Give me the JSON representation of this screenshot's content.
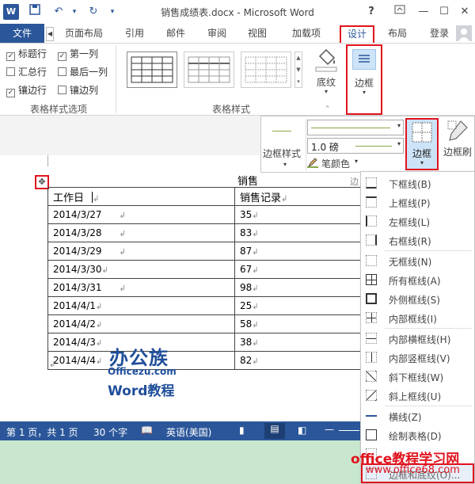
{
  "title_bar": {
    "title": "销售成绩表.docx - Microsoft Word",
    "word_icon_letter": "W",
    "help": "?",
    "min": "—",
    "restore": "☐",
    "close": "✕"
  },
  "tabs": {
    "file": "文件",
    "items": [
      "页面布局",
      "引用",
      "邮件",
      "审阅",
      "视图",
      "加载项",
      "设计",
      "布局"
    ],
    "signin": "登录"
  },
  "ribbon": {
    "options": {
      "header_row": "标题行",
      "first_column": "第一列",
      "total_row": "汇总行",
      "last_column": "最后一列",
      "banded_rows": "镶边行",
      "banded_columns": "镶边列",
      "group_label": "表格样式选项"
    },
    "styles_group_label": "表格样式",
    "shading_label": "底纹",
    "borders_label": "边框"
  },
  "border_tools": {
    "border_styles_label": "边框样式",
    "weight": "1.0 磅",
    "pen_color_label": "笔颜色",
    "borders_label": "边框",
    "border_painter_label": "边框刷"
  },
  "document": {
    "title_partial": "销售",
    "header_col1": "工作日",
    "header_col2": "销售记录",
    "right_partial": "边",
    "rows": [
      {
        "date": "2014/3/27",
        "value": "35"
      },
      {
        "date": "2014/3/28",
        "value": "83"
      },
      {
        "date": "2014/3/29",
        "value": "87"
      },
      {
        "date": "2014/3/30",
        "value": "67"
      },
      {
        "date": "2014/3/31",
        "value": "98"
      },
      {
        "date": "2014/4/1",
        "value": "25"
      },
      {
        "date": "2014/4/2",
        "value": "58"
      },
      {
        "date": "2014/4/3",
        "value": "38"
      },
      {
        "date": "2014/4/4",
        "value": "82"
      }
    ]
  },
  "border_menu": {
    "items": [
      "下框线(B)",
      "上框线(P)",
      "左框线(L)",
      "右框线(R)",
      "无框线(N)",
      "所有框线(A)",
      "外侧框线(S)",
      "内部框线(I)",
      "内部横框线(H)",
      "内部竖框线(V)",
      "斜下框线(W)",
      "斜上框线(U)",
      "横线(Z)",
      "绘制表格(D)"
    ],
    "last_partial": "边框和底纹(O)..."
  },
  "status_bar": {
    "page": "第 1 页，共 1 页",
    "words": "30 个字",
    "language": "英语(美国)"
  },
  "watermarks": {
    "logo_cn": "办公族",
    "logo_site": "Officezu.com",
    "logo_word": "Word教程",
    "site_cn": "office教程学习网",
    "site_url": "www.office68.com"
  },
  "colors": {
    "word_blue": "#2b579a",
    "highlight_red": "#e0141e"
  }
}
